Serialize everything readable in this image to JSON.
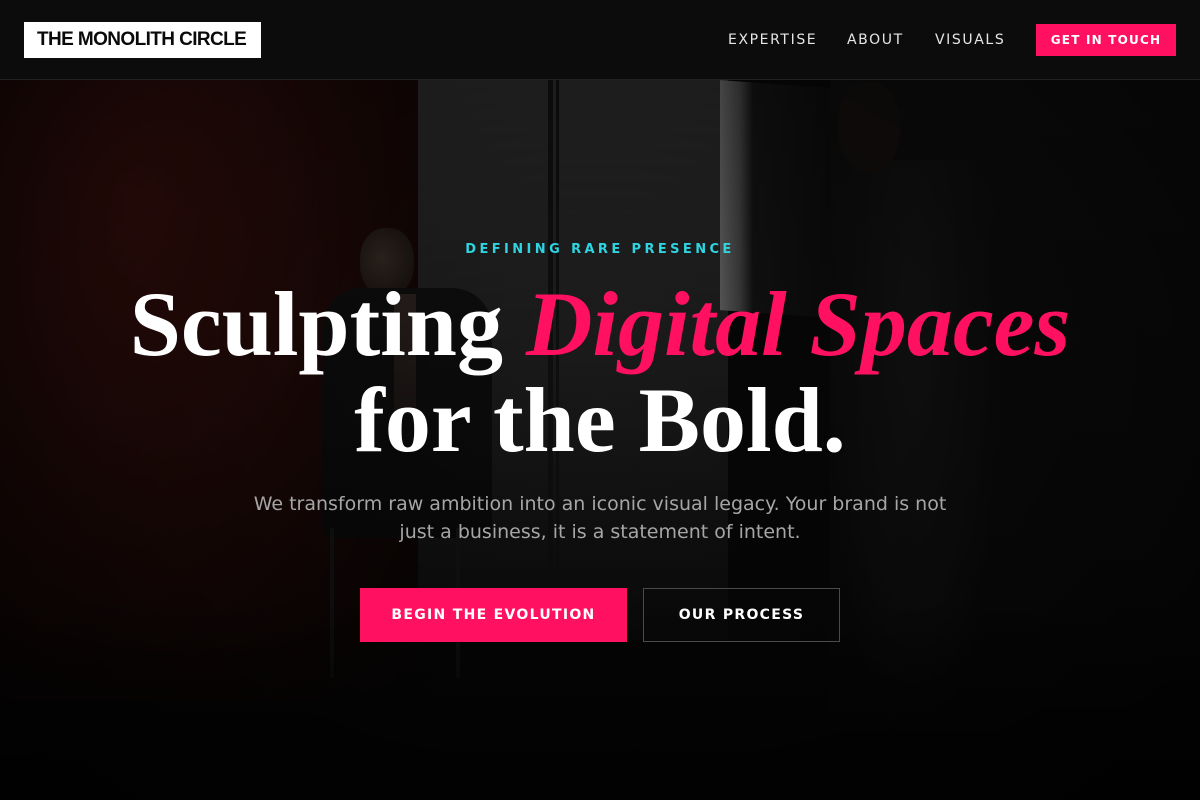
{
  "brand": {
    "logo_text": "THE MONOLITH CIRCLE"
  },
  "nav": {
    "items": [
      {
        "label": "EXPERTISE"
      },
      {
        "label": "ABOUT"
      },
      {
        "label": "VISUALS"
      }
    ],
    "cta_label": "GET IN TOUCH"
  },
  "hero": {
    "eyebrow": "DEFINING RARE PRESENCE",
    "headline": {
      "part1": "Sculpting",
      "accent": "Digital Spaces",
      "line2": "for the Bold."
    },
    "subtitle": "We transform raw ambition into an iconic visual legacy. Your brand is not just a business, it is a statement of intent.",
    "primary_button": "BEGIN THE EVOLUTION",
    "secondary_button": "OUR PROCESS"
  },
  "colors": {
    "accent": "#ff1060",
    "eyebrow": "#2fd4e0",
    "background": "#0a0a0a",
    "text": "#ffffff",
    "muted_text": "#a6a6a6"
  }
}
